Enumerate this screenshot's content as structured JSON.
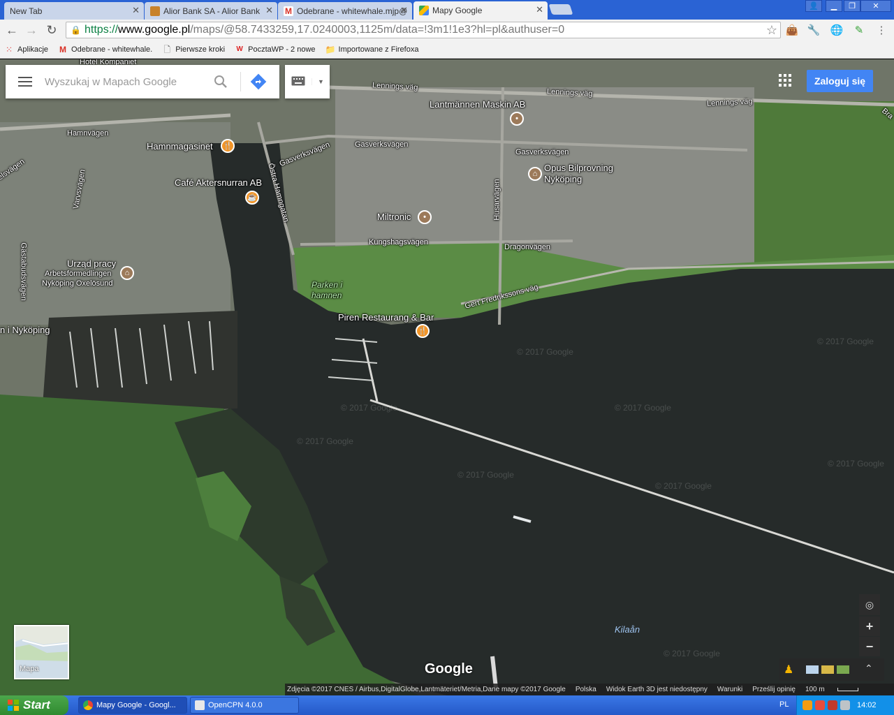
{
  "browser": {
    "tabs": [
      {
        "label": "New Tab",
        "active": false
      },
      {
        "label": "Alior Bank SA - Alior Bank",
        "active": false
      },
      {
        "label": "Odebrane - whitewhale.mjp@",
        "active": false
      },
      {
        "label": "Mapy Google",
        "active": true
      }
    ],
    "url": {
      "scheme": "https://",
      "host": "www.google.pl",
      "path": "/maps/@58.7433259,17.0240003,1125m/data=!3m1!1e3?hl=pl&authuser=0"
    },
    "bookmarks": [
      {
        "label": "Aplikacje",
        "icon": "apps-grid-icon"
      },
      {
        "label": "Odebrane - whitewhale.",
        "icon": "gmail-icon"
      },
      {
        "label": "Pierwsze kroki",
        "icon": "page-icon"
      },
      {
        "label": "PocztaWP - 2 nowe",
        "icon": "wp-icon"
      },
      {
        "label": "Importowane z Firefoxa",
        "icon": "folder-icon"
      }
    ]
  },
  "maps": {
    "search_placeholder": "Wyszukaj w Mapach Google",
    "signin_label": "Zaloguj się",
    "minimap_label": "Mapa",
    "logo_text": "Google",
    "labels": {
      "hotel": "Hotel Kompaniet",
      "lennings1": "Lennings väg",
      "lennings2": "Lennings väg",
      "lennings3": "Lennings väg",
      "lantmannen": "Lantmännen Maskin AB",
      "hamnvagen": "Hamnvägen",
      "hamnmagasinet": "Hamnmagasinet",
      "gasverksvagen1": "Gasverksvägen",
      "gasverksvagen2": "Gasverksvägen",
      "gasverksvagen3": "Gasverksvägen",
      "opus": "Opus Bilprovning",
      "opus2": "Nyköping",
      "cafe": "Café Aktersnurran AB",
      "ostra": "Östra Hamngatan",
      "varvsvagen": "Varvsvägen",
      "husarvagen": "Husarvägen",
      "miltronic": "Miltronic",
      "kungshagsvagen": "Kungshagsvägen",
      "dragonvagen": "Dragonvägen",
      "urzad1": "Urząd pracy",
      "urzad2": "Arbetsförmedlingen",
      "urzad3": "Nyköping Oxelösund",
      "gastabudsvagen": "Gästabudsvägen",
      "parken1": "Parken i",
      "parken2": "hamnen",
      "gert": "Gert Fredrikssons väg",
      "piren": "Piren Restaurang & Bar",
      "nykoping": "n i Nyköping",
      "kilaan": "Kilaån",
      "bra": "Bra",
      "west": "elsvägen"
    },
    "watermark_text": "© 2017 Google",
    "attribution": {
      "data": "Zdjęcia ©2017 CNES / Airbus,DigitalGlobe,Lantmäteriet/Metria,Dane mapy ©2017 Google",
      "country": "Polska",
      "earth": "Widok Earth 3D jest niedostępny",
      "terms": "Warunki",
      "feedback": "Prześlij opinię",
      "scale": "100 m"
    }
  },
  "taskbar": {
    "start_label": "Start",
    "tasks": [
      {
        "label": "Mapy Google - Googl...",
        "active": true
      },
      {
        "label": "OpenCPN 4.0.0",
        "active": false
      }
    ],
    "language": "PL",
    "clock": "14:02"
  }
}
